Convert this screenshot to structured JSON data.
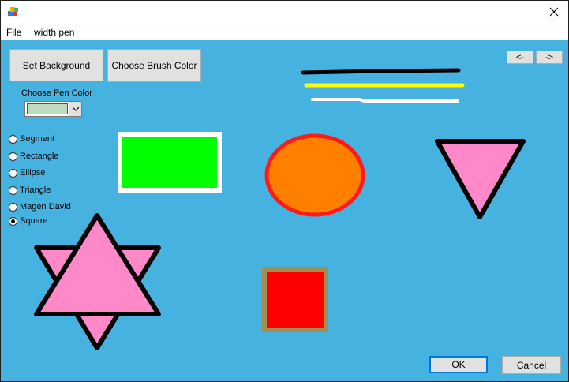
{
  "menu": {
    "file": "File",
    "width_pen": "width pen"
  },
  "buttons": {
    "set_background": "Set Background",
    "choose_brush_color": "Choose Brush Color",
    "prev": "<-",
    "next": "->",
    "ok": "OK",
    "cancel": "Cancel"
  },
  "pen_color_label": "Choose Pen Color",
  "pen_color_value": "#c0dcc0",
  "shape_options": [
    {
      "label": "Segment",
      "checked": false
    },
    {
      "label": "Rectangle",
      "checked": false
    },
    {
      "label": "Ellipse",
      "checked": false
    },
    {
      "label": "Triangle",
      "checked": false
    },
    {
      "label": "Magen David",
      "checked": false
    },
    {
      "label": "Square",
      "checked": true
    }
  ],
  "colors": {
    "canvas_background": "#45b2e0",
    "rectangle_fill": "#00ff00",
    "rectangle_border": "#ffffff",
    "ellipse_fill": "#ff8000",
    "ellipse_border": "#ff1a1a",
    "triangle_fill": "#ff88c8",
    "shape_border": "#000000",
    "square_fill": "#ff0000",
    "square_border": "#a38d52",
    "line_1": "#000000",
    "line_2": "#ffff00",
    "line_3": "#ffffff"
  }
}
